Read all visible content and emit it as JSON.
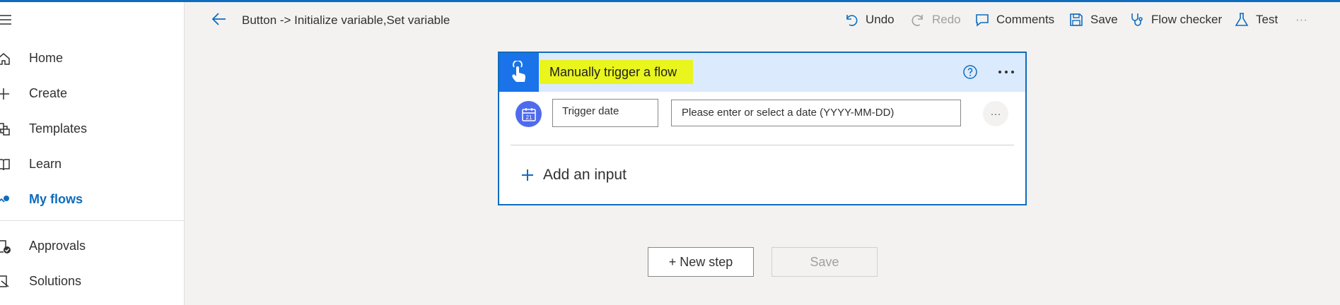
{
  "sidebar": {
    "items": [
      {
        "label": "Home",
        "icon": "home-icon"
      },
      {
        "label": "Create",
        "icon": "plus-icon"
      },
      {
        "label": "Templates",
        "icon": "templates-icon"
      },
      {
        "label": "Learn",
        "icon": "book-icon"
      },
      {
        "label": "My flows",
        "icon": "flows-icon",
        "active": true
      },
      {
        "label": "Approvals",
        "icon": "approvals-icon"
      },
      {
        "label": "Solutions",
        "icon": "solutions-icon"
      }
    ]
  },
  "commandbar": {
    "title": "Button -> Initialize variable,Set variable",
    "undo": "Undo",
    "redo": "Redo",
    "comments": "Comments",
    "save": "Save",
    "flow_checker": "Flow checker",
    "test": "Test",
    "more": "···"
  },
  "card": {
    "title": "Manually trigger a flow",
    "input_name": "Trigger date",
    "input_placeholder": "Please enter or select a date (YYYY-MM-DD)",
    "row_more": "···",
    "add_input": "Add an input",
    "calendar_day": "21"
  },
  "buttons": {
    "new_step": "+ New step",
    "save": "Save"
  },
  "colors": {
    "accent": "#0f6cbd",
    "trigger_blue": "#1a73e8",
    "header_bg": "#dbeafc",
    "highlight": "#e9f51c",
    "calendar_circle": "#4f6bed"
  }
}
